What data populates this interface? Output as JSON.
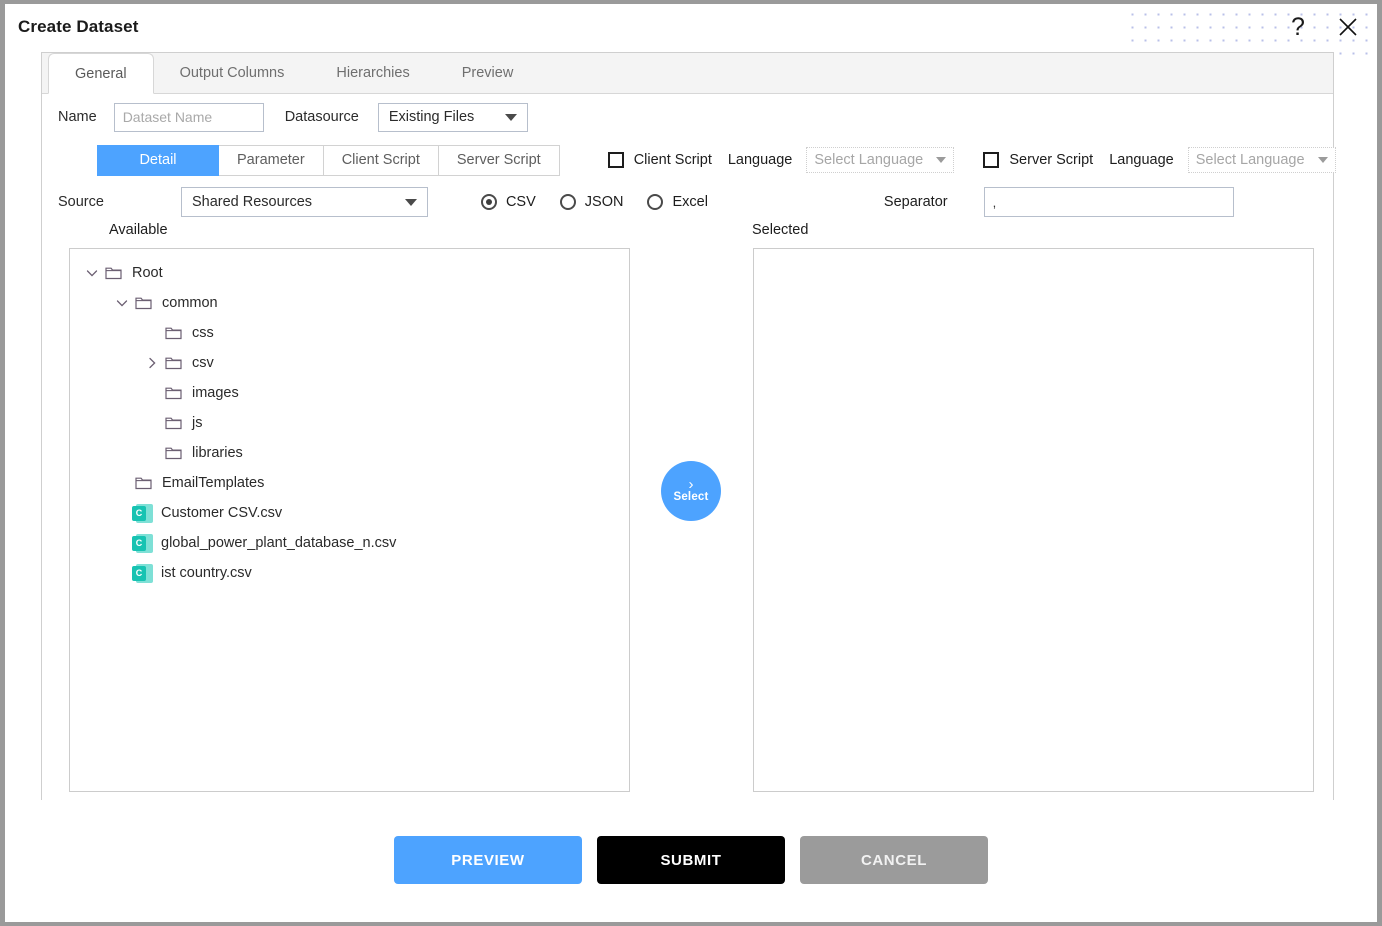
{
  "window": {
    "title": "Create Dataset",
    "help_icon": "?",
    "close_icon": "×"
  },
  "tabs": [
    {
      "label": "General",
      "active": true
    },
    {
      "label": "Output Columns",
      "active": false
    },
    {
      "label": "Hierarchies",
      "active": false
    },
    {
      "label": "Preview",
      "active": false
    }
  ],
  "form": {
    "name_label": "Name",
    "name_value": "",
    "name_placeholder": "Dataset Name",
    "datasource_label": "Datasource",
    "datasource_value": "Existing Files"
  },
  "subtabs": [
    {
      "label": "Detail",
      "selected": true
    },
    {
      "label": "Parameter",
      "selected": false
    },
    {
      "label": "Client Script",
      "selected": false
    },
    {
      "label": "Server Script",
      "selected": false
    }
  ],
  "scripts": {
    "client": {
      "checkbox_label": "Client Script",
      "checked": false,
      "language_label": "Language",
      "language_value": "Select Language"
    },
    "server": {
      "checkbox_label": "Server Script",
      "checked": false,
      "language_label": "Language",
      "language_value": "Select Language"
    }
  },
  "detail": {
    "source_label": "Source",
    "source_value": "Shared Resources",
    "formats": [
      {
        "label": "CSV",
        "selected": true
      },
      {
        "label": "JSON",
        "selected": false
      },
      {
        "label": "Excel",
        "selected": false
      }
    ],
    "separator_label": "Separator",
    "separator_value": ",",
    "available_label": "Available",
    "selected_label": "Selected",
    "select_button": {
      "label": "Select",
      "icon": "chevron-right-icon"
    },
    "tree": [
      {
        "label": "Root",
        "depth": 0,
        "type": "folder",
        "twisty": "expanded"
      },
      {
        "label": "common",
        "depth": 1,
        "type": "folder",
        "twisty": "expanded"
      },
      {
        "label": "css",
        "depth": 2,
        "type": "folder",
        "twisty": "none"
      },
      {
        "label": "csv",
        "depth": 2,
        "type": "folder",
        "twisty": "collapsed"
      },
      {
        "label": "images",
        "depth": 2,
        "type": "folder",
        "twisty": "none"
      },
      {
        "label": "js",
        "depth": 2,
        "type": "folder",
        "twisty": "none"
      },
      {
        "label": "libraries",
        "depth": 2,
        "type": "folder",
        "twisty": "none"
      },
      {
        "label": "EmailTemplates",
        "depth": 1,
        "type": "folder",
        "twisty": "none"
      },
      {
        "label": "Customer CSV.csv",
        "depth": 1,
        "type": "csv",
        "twisty": "none"
      },
      {
        "label": "global_power_plant_database_n.csv",
        "depth": 1,
        "type": "csv",
        "twisty": "none"
      },
      {
        "label": "ist country.csv",
        "depth": 1,
        "type": "csv",
        "twisty": "none"
      }
    ],
    "selected_items": []
  },
  "footer": {
    "preview_label": "PREVIEW",
    "submit_label": "SUBMIT",
    "cancel_label": "CANCEL"
  },
  "colors": {
    "accent": "#4da3ff",
    "submit": "#000000",
    "cancel": "#9b9b9b",
    "csv_icon": "#17c3b2",
    "dots": "#b9c0e8"
  }
}
